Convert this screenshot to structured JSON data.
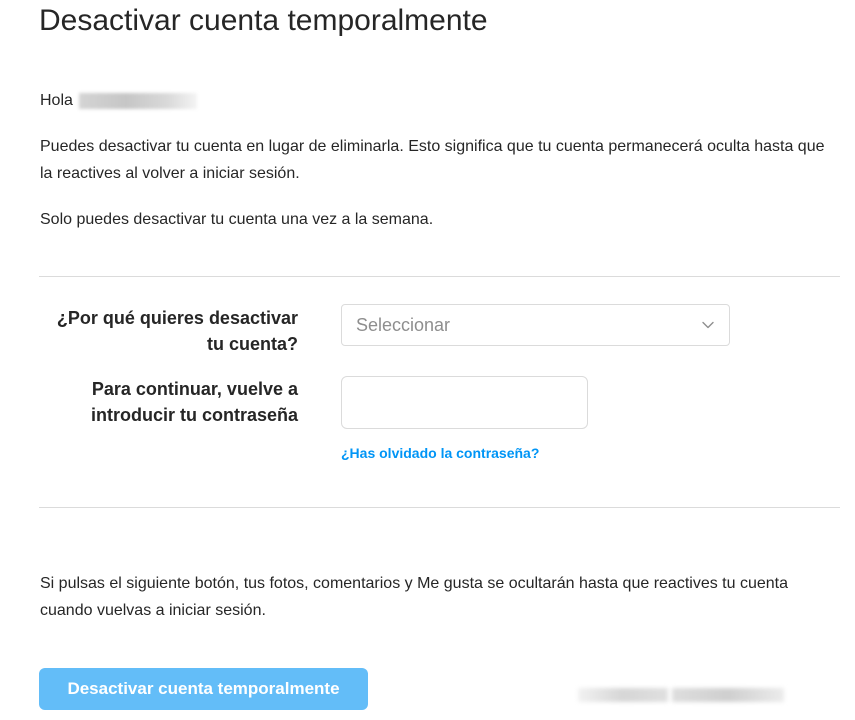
{
  "page": {
    "title": "Desactivar cuenta temporalmente",
    "greeting": "Hola",
    "intro": "Puedes desactivar tu cuenta en lugar de eliminarla. Esto significa que tu cuenta permanecerá oculta hasta que la reactives al volver a iniciar sesión.",
    "frequency_note": "Solo puedes desactivar tu cuenta una vez a la semana."
  },
  "form": {
    "reason_label": "¿Por qué quieres desactivar tu cuenta?",
    "reason_select": {
      "selected": "Seleccionar"
    },
    "password_label": "Para continuar, vuelve a introducir tu contraseña",
    "password_value": "",
    "forgot_password_link": "¿Has olvidado la contraseña?"
  },
  "footer": {
    "warning": "Si pulsas el siguiente botón, tus fotos, comentarios y Me gusta se ocultarán hasta que reactives tu cuenta cuando vuelvas a iniciar sesión.",
    "submit_label": "Desactivar cuenta temporalmente"
  },
  "colors": {
    "accent": "#0095f6",
    "button_disabled": "#63bdf8",
    "text": "#262626",
    "border": "#dbdbdb"
  },
  "icons": {
    "select_chevron": "chevron-down-icon"
  }
}
